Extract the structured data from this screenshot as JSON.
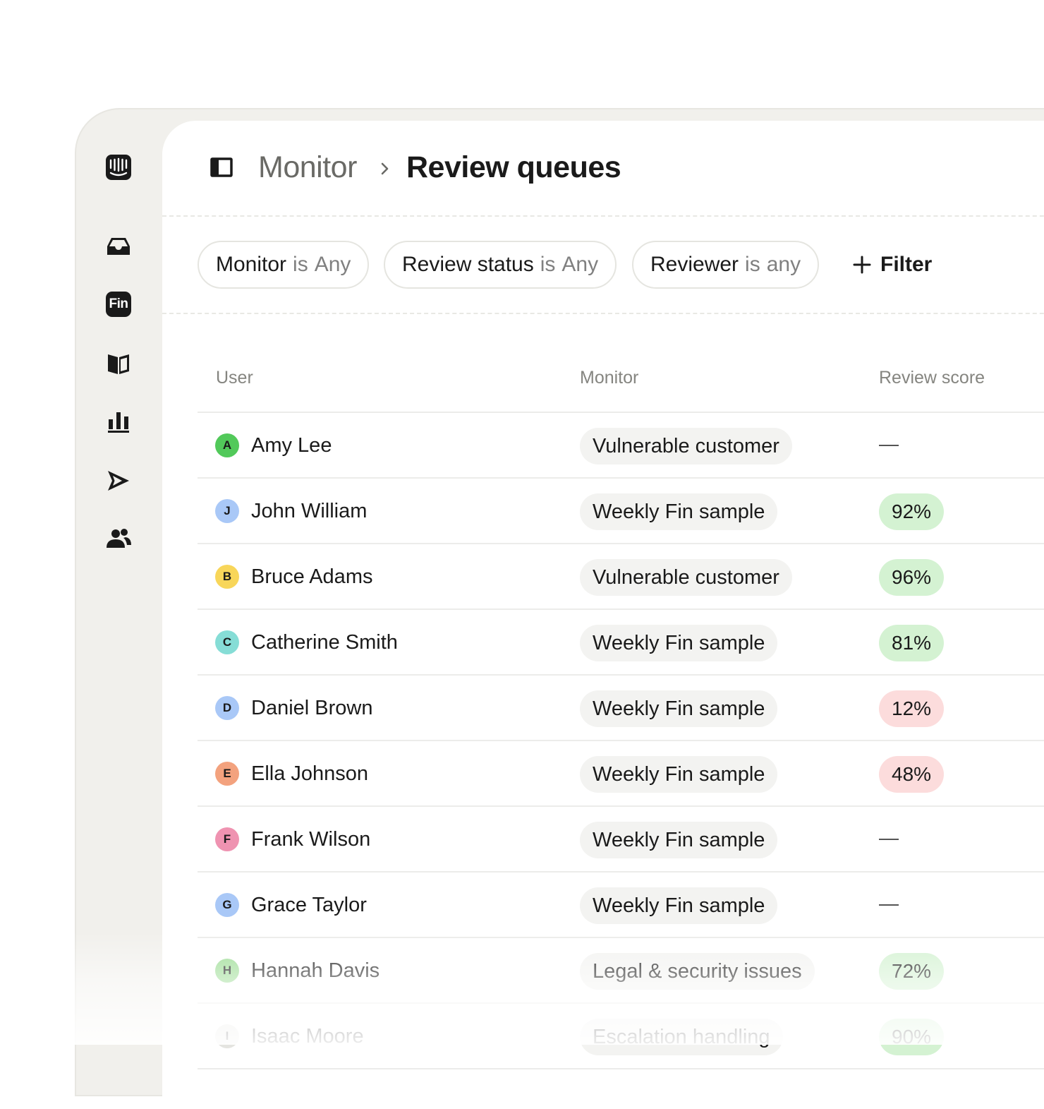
{
  "breadcrumb": {
    "parent": "Monitor",
    "current": "Review queues"
  },
  "sidebar": {
    "items": [
      {
        "icon": "intercom-logo-icon"
      },
      {
        "icon": "inbox-icon"
      },
      {
        "icon": "fin-icon",
        "label": "Fin"
      },
      {
        "icon": "knowledge-book-icon"
      },
      {
        "icon": "reports-bar-chart-icon"
      },
      {
        "icon": "outbound-send-icon"
      },
      {
        "icon": "contacts-people-icon"
      }
    ]
  },
  "filters": [
    {
      "field": "Monitor",
      "op": "is",
      "value": "Any"
    },
    {
      "field": "Review status",
      "op": "is",
      "value": "Any"
    },
    {
      "field": "Reviewer",
      "op": "is",
      "value": "any"
    }
  ],
  "add_filter_label": "Filter",
  "table": {
    "columns": [
      "User",
      "Monitor",
      "Review score"
    ],
    "rows": [
      {
        "initial": "A",
        "name": "Amy Lee",
        "monitor": "Vulnerable customer",
        "score": "—",
        "avatar_color": "#52c95a",
        "score_status": "none"
      },
      {
        "initial": "J",
        "name": "John William",
        "monitor": "Weekly Fin sample",
        "score": "92%",
        "avatar_color": "#a9c8f7",
        "score_status": "good"
      },
      {
        "initial": "B",
        "name": "Bruce Adams",
        "monitor": "Vulnerable customer",
        "score": "96%",
        "avatar_color": "#f8d65a",
        "score_status": "good"
      },
      {
        "initial": "C",
        "name": "Catherine Smith",
        "monitor": "Weekly Fin sample",
        "score": "81%",
        "avatar_color": "#86ddd6",
        "score_status": "good"
      },
      {
        "initial": "D",
        "name": "Daniel Brown",
        "monitor": "Weekly Fin sample",
        "score": "12%",
        "avatar_color": "#a9c8f7",
        "score_status": "bad"
      },
      {
        "initial": "E",
        "name": "Ella Johnson",
        "monitor": "Weekly Fin sample",
        "score": "48%",
        "avatar_color": "#f3a27e",
        "score_status": "bad"
      },
      {
        "initial": "F",
        "name": "Frank Wilson",
        "monitor": "Weekly Fin sample",
        "score": "—",
        "avatar_color": "#ef93b1",
        "score_status": "none"
      },
      {
        "initial": "G",
        "name": "Grace Taylor",
        "monitor": "Weekly Fin sample",
        "score": "—",
        "avatar_color": "#a9c8f7",
        "score_status": "none"
      },
      {
        "initial": "H",
        "name": "Hannah Davis",
        "monitor": "Legal & security issues",
        "score": "72%",
        "avatar_color": "#9bdc93",
        "score_status": "good"
      },
      {
        "initial": "I",
        "name": "Isaac Moore",
        "monitor": "Escalation handling",
        "score": "90%",
        "avatar_color": "#e4e4e0",
        "score_status": "good"
      }
    ]
  },
  "colors": {
    "good_bg": "#d4f2d2",
    "bad_bg": "#fcdcdc",
    "sidebar_bg": "#f1f0ec"
  }
}
